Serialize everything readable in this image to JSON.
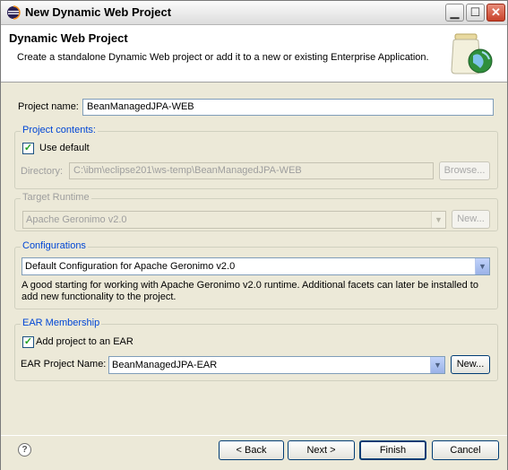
{
  "window": {
    "title": "New Dynamic Web Project"
  },
  "header": {
    "title": "Dynamic Web Project",
    "description": "Create a standalone Dynamic Web project or add it to a new or existing Enterprise Application."
  },
  "project_name": {
    "label": "Project name:",
    "value": "BeanManagedJPA-WEB"
  },
  "project_contents": {
    "title": "Project contents:",
    "use_default_label": "Use default",
    "use_default_checked": true,
    "directory_label": "Directory:",
    "directory_value": "C:\\ibm\\eclipse201\\ws-temp\\BeanManagedJPA-WEB",
    "browse_label": "Browse..."
  },
  "target_runtime": {
    "title": "Target Runtime",
    "selected": "Apache Geronimo v2.0",
    "new_label": "New..."
  },
  "configurations": {
    "title": "Configurations",
    "selected": "Default Configuration for Apache Geronimo v2.0",
    "description_line1": "A good starting for working with Apache Geronimo v2.0 runtime. Additional facets can later be installed to",
    "description_line2": "add new functionality to the project."
  },
  "ear": {
    "title": "EAR Membership",
    "add_label": "Add project to an EAR",
    "add_checked": true,
    "project_name_label": "EAR Project Name:",
    "project_name_value": "BeanManagedJPA-EAR",
    "new_label": "New..."
  },
  "footer": {
    "help": "?",
    "back_label": "< Back",
    "next_label": "Next >",
    "finish_label": "Finish",
    "cancel_label": "Cancel"
  },
  "colors": {
    "group_title": "#0046d5",
    "dialog_bg": "#ece9d8",
    "check": "#21a121"
  }
}
